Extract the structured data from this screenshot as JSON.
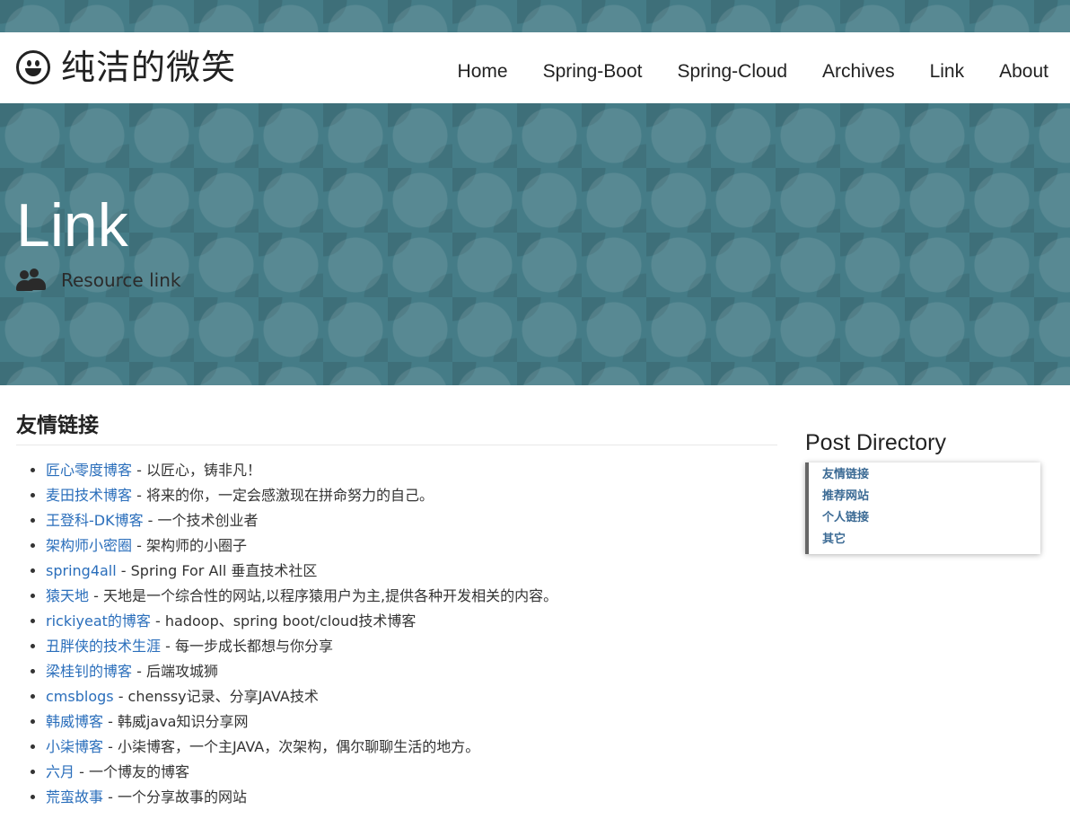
{
  "site": {
    "brand": "纯洁的微笑"
  },
  "nav": {
    "items": [
      {
        "label": "Home"
      },
      {
        "label": "Spring-Boot"
      },
      {
        "label": "Spring-Cloud"
      },
      {
        "label": "Archives"
      },
      {
        "label": "Link"
      },
      {
        "label": "About"
      }
    ]
  },
  "hero": {
    "title": "Link",
    "subtitle": "Resource link"
  },
  "main": {
    "section_title": "友情链接",
    "links": [
      {
        "name": "匠心零度博客",
        "desc": " - 以匠心，铸非凡！"
      },
      {
        "name": "麦田技术博客",
        "desc": " - 将来的你，一定会感激现在拼命努力的自己。"
      },
      {
        "name": "王登科-DK博客",
        "desc": " - 一个技术创业者"
      },
      {
        "name": "架构师小密圈",
        "desc": " - 架构师的小圈子"
      },
      {
        "name": "spring4all",
        "desc": " - Spring For All 垂直技术社区"
      },
      {
        "name": "猿天地",
        "desc": " - 天地是一个综合性的网站,以程序猿用户为主,提供各种开发相关的内容。"
      },
      {
        "name": "rickiyeat的博客",
        "desc": " - hadoop、spring boot/cloud技术博客"
      },
      {
        "name": "丑胖侠的技术生涯",
        "desc": " - 每一步成长都想与你分享"
      },
      {
        "name": "梁桂钊的博客",
        "desc": " - 后端攻城狮"
      },
      {
        "name": "cmsblogs",
        "desc": " - chenssy记录、分享JAVA技术"
      },
      {
        "name": "韩威博客",
        "desc": " - 韩威java知识分享网"
      },
      {
        "name": "小柒博客",
        "desc": " - 小柒博客，一个主JAVA，次架构，偶尔聊聊生活的地方。"
      },
      {
        "name": "六月",
        "desc": " - 一个博友的博客"
      },
      {
        "name": "荒蛮故事",
        "desc": " - 一个分享故事的网站"
      }
    ]
  },
  "sidebar": {
    "title": "Post Directory",
    "items": [
      {
        "label": "友情链接"
      },
      {
        "label": "推荐网站"
      },
      {
        "label": "个人链接"
      },
      {
        "label": "其它"
      }
    ]
  },
  "colors": {
    "hero_bg": "#457c87",
    "link": "#2a6ebb",
    "toc_link": "#3b6a94"
  }
}
